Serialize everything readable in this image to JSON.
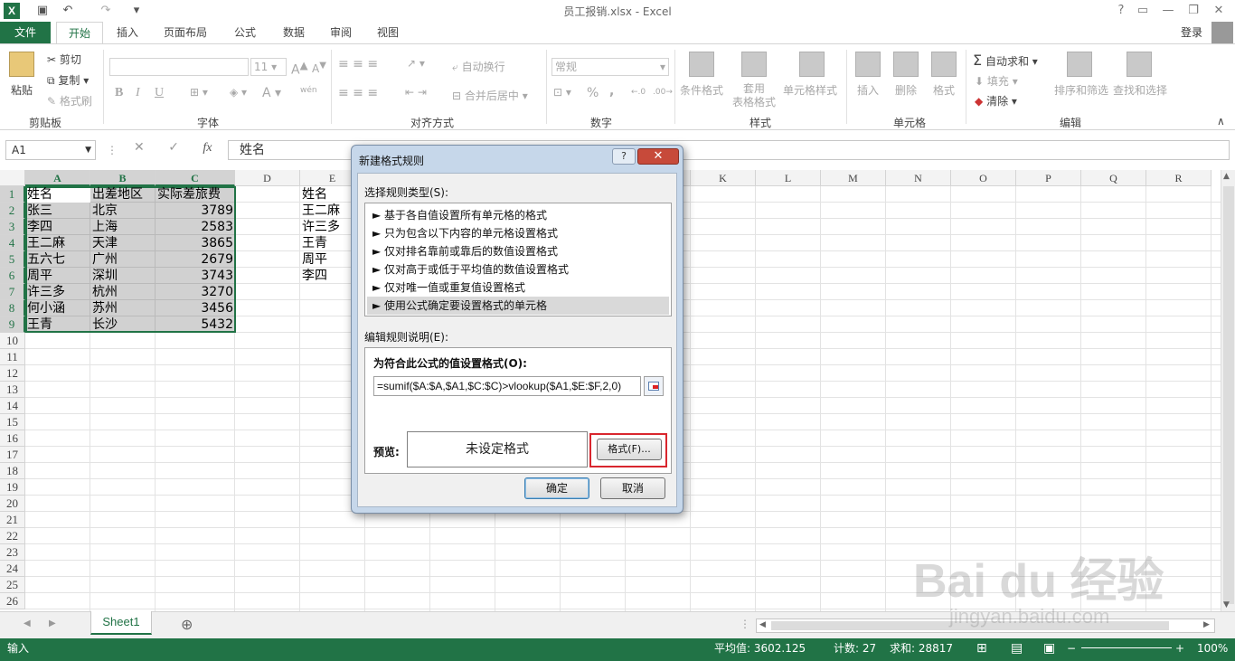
{
  "titlebar": {
    "app_icon": "X",
    "title": "员工报销.xlsx - Excel",
    "help": "?",
    "minimize": "—",
    "restore": "❐",
    "close": "✕"
  },
  "tabs": [
    "文件",
    "开始",
    "插入",
    "页面布局",
    "公式",
    "数据",
    "审阅",
    "视图"
  ],
  "login": "登录",
  "ribbon": {
    "clipboard": {
      "paste": "粘贴",
      "cut": "剪切",
      "copy": "复制",
      "format_painter": "格式刷",
      "label": "剪贴板"
    },
    "font": {
      "size": "11",
      "bold": "B",
      "italic": "I",
      "underline": "U",
      "wen": "wén",
      "label": "字体"
    },
    "align": {
      "wrap": "自动换行",
      "merge": "合并后居中",
      "label": "对齐方式"
    },
    "number": {
      "format": "常规",
      "percent": "%",
      "comma": ",",
      "label": "数字"
    },
    "styles": {
      "conditional": "条件格式",
      "table": "套用\n表格格式",
      "cell_styles": "单元格样式",
      "label": "样式"
    },
    "cells": {
      "insert": "插入",
      "delete": "删除",
      "format": "格式",
      "label": "单元格"
    },
    "editing": {
      "autosum": "自动求和",
      "fill": "填充",
      "clear": "清除",
      "sort": "排序和筛选",
      "find": "查找和选择",
      "label": "编辑"
    }
  },
  "formula_bar": {
    "name_box": "A1",
    "fx": "fx",
    "content": "姓名"
  },
  "columns": [
    "A",
    "B",
    "C",
    "D",
    "E",
    "F",
    "G",
    "H",
    "I",
    "J",
    "K",
    "L",
    "M",
    "N",
    "O",
    "P",
    "Q",
    "R"
  ],
  "rows": [
    "1",
    "2",
    "3",
    "4",
    "5",
    "6",
    "7",
    "8",
    "9",
    "10",
    "11",
    "12",
    "13",
    "14",
    "15",
    "16",
    "17",
    "18",
    "19",
    "20",
    "21",
    "22",
    "23",
    "24",
    "25",
    "26"
  ],
  "table": {
    "header": [
      "姓名",
      "出差地区",
      "实际差旅费"
    ],
    "data": [
      [
        "张三",
        "北京",
        "3789"
      ],
      [
        "李四",
        "上海",
        "2583"
      ],
      [
        "王二麻",
        "天津",
        "3865"
      ],
      [
        "五六七",
        "广州",
        "2679"
      ],
      [
        "周平",
        "深圳",
        "3743"
      ],
      [
        "许三多",
        "杭州",
        "3270"
      ],
      [
        "何小涵",
        "苏州",
        "3456"
      ],
      [
        "王青",
        "长沙",
        "5432"
      ]
    ]
  },
  "col_e": [
    "姓名",
    "王二麻",
    "许三多",
    "王青",
    "周平",
    "李四"
  ],
  "sheet_tab": "Sheet1",
  "add_sheet": "⊕",
  "status": {
    "mode": "输入",
    "average": "平均值: 3602.125",
    "count": "计数: 27",
    "sum": "求和: 28817",
    "zoom": "100%"
  },
  "dialog": {
    "title": "新建格式规则",
    "help": "?",
    "close": "✕",
    "select_type_label": "选择规则类型(S):",
    "rule_types": [
      "► 基于各自值设置所有单元格的格式",
      "► 只为包含以下内容的单元格设置格式",
      "► 仅对排名靠前或靠后的数值设置格式",
      "► 仅对高于或低于平均值的数值设置格式",
      "► 仅对唯一值或重复值设置格式",
      "► 使用公式确定要设置格式的单元格"
    ],
    "edit_desc_label": "编辑规则说明(E):",
    "formula_label": "为符合此公式的值设置格式(O):",
    "formula": "=sumif($A:$A,$A1,$C:$C)>vlookup($A1,$E:$F,2,0)",
    "preview_label": "预览:",
    "preview_text": "未设定格式",
    "format_button": "格式(F)...",
    "ok": "确定",
    "cancel": "取消"
  },
  "watermark": "Bai du 经验",
  "watermark_url": "jingyan.baidu.com"
}
